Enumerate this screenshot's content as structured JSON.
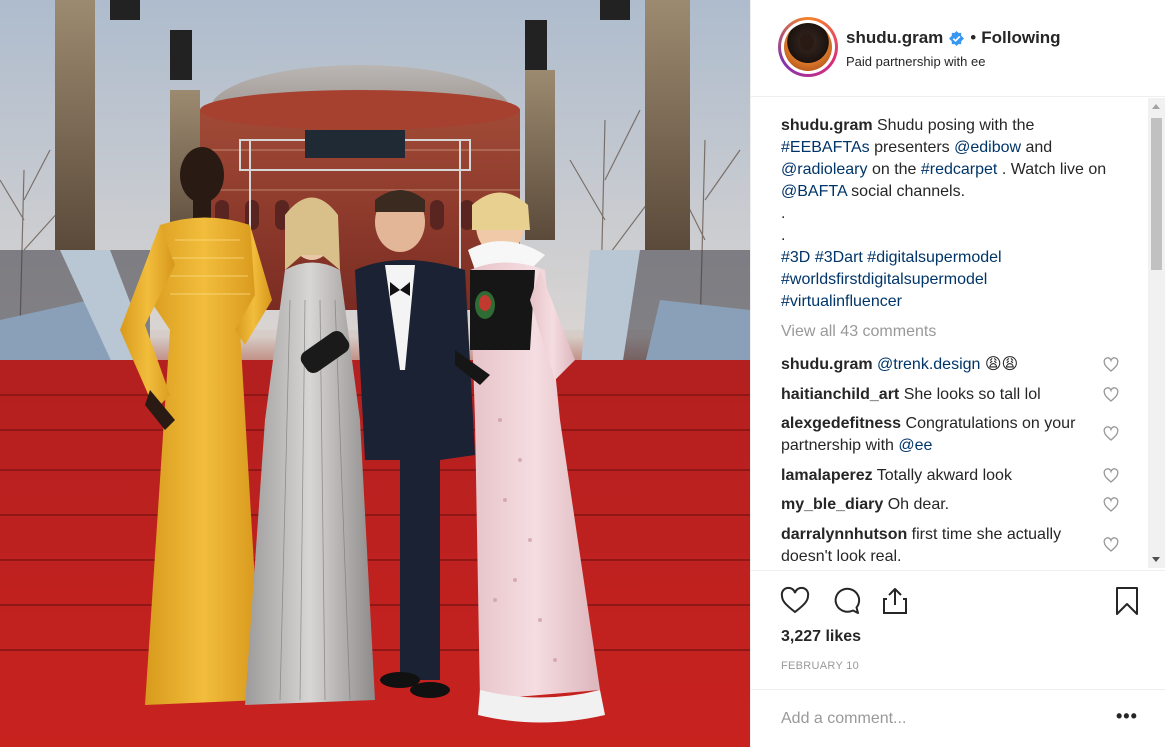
{
  "header": {
    "username": "shudu.gram",
    "dot": "•",
    "following": "Following",
    "subline_prefix": "Paid partnership with ",
    "partner": "ee"
  },
  "caption": {
    "username": "shudu.gram",
    "t1": " Shudu posing with the ",
    "tag1": "#EEBAFTAs",
    "t2": " presenters ",
    "mention1": "@edibow",
    "t3": " and ",
    "mention2": "@radioleary",
    "t4": " on the ",
    "tag2": "#redcarpet",
    "t5": " . Watch live on ",
    "mention3": "@BAFTA",
    "t6": " social channels.",
    "dot1": ".",
    "dot2": ".",
    "tags_line1_a": "#3D",
    "tags_line1_b": "#3Dart",
    "tags_line1_c": "#digitalsupermodel",
    "tags_line2": "#worldsfirstdigitalsupermodel",
    "tags_line3": "#virtualinfluencer"
  },
  "view_all": "View all 43 comments",
  "comments": [
    {
      "user": "shudu.gram",
      "text": "",
      "mention": "@trenk.design",
      "emoji": "😩😩"
    },
    {
      "user": "haitianchild_art",
      "text": " She looks so tall lol"
    },
    {
      "user": "alexgedefitness",
      "text": " Congratulations on your partnership with ",
      "mention": "@ee"
    },
    {
      "user": "lamalaperez",
      "text": " Totally akward look"
    },
    {
      "user": "my_ble_diary",
      "text": " Oh dear."
    },
    {
      "user": "darralynnhutson",
      "text": " first time she actually doesn't look real."
    }
  ],
  "likes": "3,227 likes",
  "date": "FEBRUARY 10",
  "add_comment_placeholder": "Add a comment...",
  "more": "•••",
  "icons": {
    "verified": "verified-badge-icon",
    "like": "heart-icon",
    "comment": "speech-bubble-icon",
    "share": "share-icon",
    "save": "bookmark-icon"
  },
  "colors": {
    "link": "#003569",
    "verified": "#3897f0",
    "muted": "#999999"
  }
}
